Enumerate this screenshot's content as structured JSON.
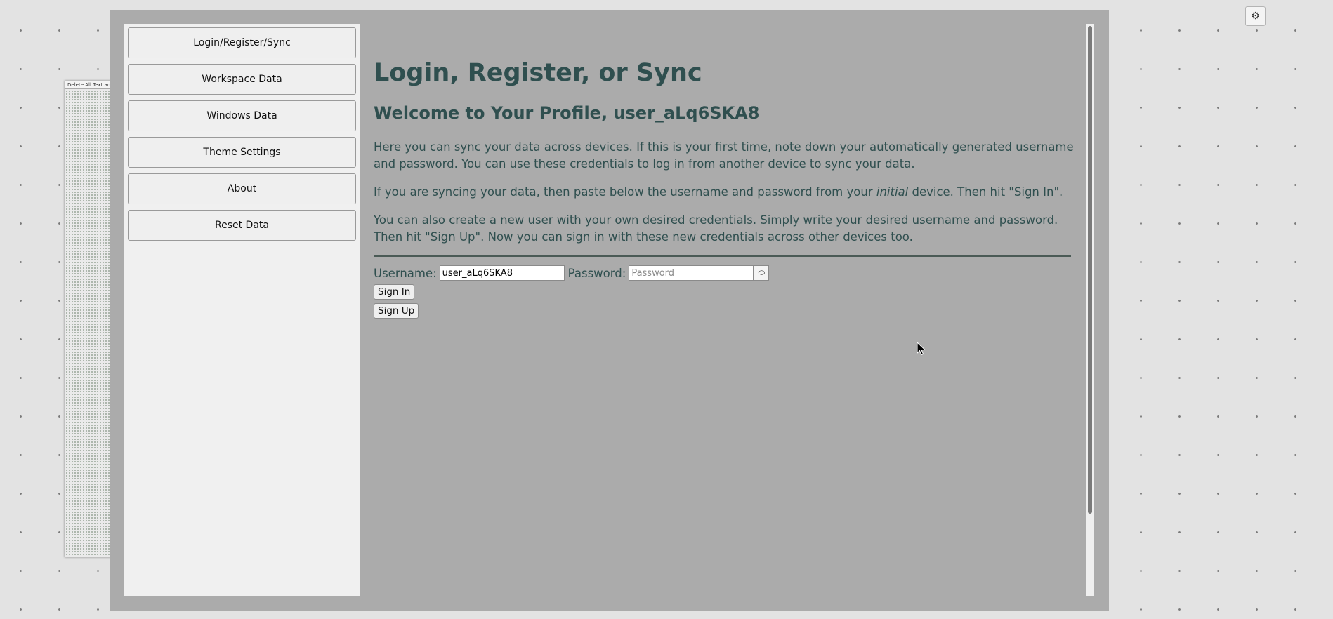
{
  "background_window": {
    "title": "Delete All Text and"
  },
  "settings_button": {
    "icon": "gear-icon",
    "glyph": "⚙"
  },
  "sidebar": {
    "items": [
      {
        "label": "Login/Register/Sync"
      },
      {
        "label": "Workspace Data"
      },
      {
        "label": "Windows Data"
      },
      {
        "label": "Theme Settings"
      },
      {
        "label": "About"
      },
      {
        "label": "Reset Data"
      }
    ]
  },
  "content": {
    "title": "Login, Register, or Sync",
    "welcome": "Welcome to Your Profile, user_aLq6SKA8",
    "paragraph1": "Here you can sync your data across devices. If this is your first time, note down your automatically generated username and password. You can use these credentials to log in from another device to sync your data.",
    "paragraph2_before": "If you are syncing your data, then paste below the username and password from your ",
    "paragraph2_em": "initial",
    "paragraph2_after": " device. Then hit \"Sign In\".",
    "paragraph3": "You can also create a new user with your own desired credentials. Simply write your desired username and password. Then hit \"Sign Up\". Now you can sign in with these new credentials across other devices too."
  },
  "form": {
    "username_label": "Username:",
    "username_value": "user_aLq6SKA8",
    "password_label": "Password:",
    "password_placeholder": "Password",
    "password_value": "",
    "toggle_icon": "eye-icon",
    "toggle_glyph": "⬭",
    "sign_in_label": "Sign In",
    "sign_up_label": "Sign Up"
  },
  "colors": {
    "modal_bg": "#ababab",
    "sidebar_bg": "#f0f0f0",
    "text": "#2f4f4f"
  }
}
